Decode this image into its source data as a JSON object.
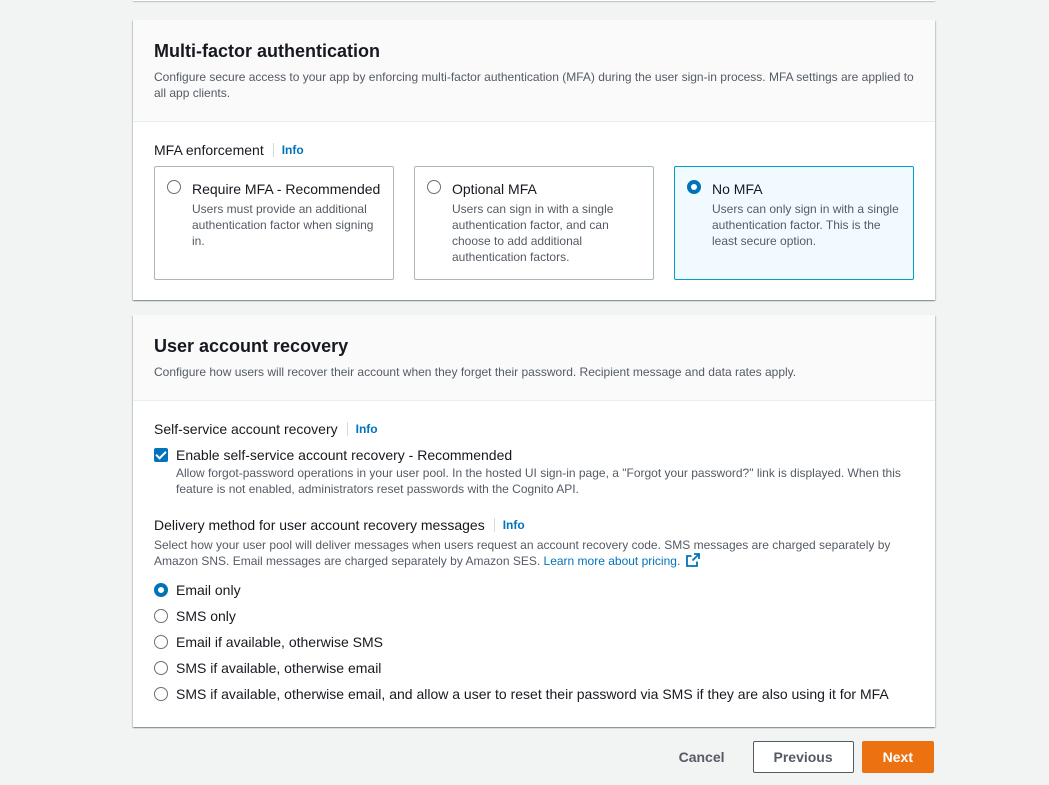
{
  "mfa": {
    "title": "Multi-factor authentication",
    "description": "Configure secure access to your app by enforcing multi-factor authentication (MFA) during the user sign-in process. MFA settings are applied to all app clients.",
    "enforcement_label": "MFA enforcement",
    "info": "Info",
    "options": [
      {
        "title": "Require MFA - Recommended",
        "desc": "Users must provide an additional authentication factor when signing in.",
        "selected": false
      },
      {
        "title": "Optional MFA",
        "desc": "Users can sign in with a single authentication factor, and can choose to add additional authentication factors.",
        "selected": false
      },
      {
        "title": "No MFA",
        "desc": "Users can only sign in with a single authentication factor. This is the least secure option.",
        "selected": true
      }
    ]
  },
  "recovery": {
    "title": "User account recovery",
    "description": "Configure how users will recover their account when they forget their password. Recipient message and data rates apply.",
    "self_service_label": "Self-service account recovery",
    "info": "Info",
    "self_service_checkbox": {
      "label": "Enable self-service account recovery - Recommended",
      "desc": "Allow forgot-password operations in your user pool. In the hosted UI sign-in page, a \"Forgot your password?\" link is displayed. When this feature is not enabled, administrators reset passwords with the Cognito API.",
      "checked": true
    },
    "delivery_label": "Delivery method for user account recovery messages",
    "delivery_desc": "Select how your user pool will deliver messages when users request an account recovery code. SMS messages are charged separately by Amazon SNS. Email messages are charged separately by Amazon SES.",
    "learn_more": "Learn more about pricing.",
    "delivery_options": [
      {
        "label": "Email only",
        "selected": true
      },
      {
        "label": "SMS only",
        "selected": false
      },
      {
        "label": "Email if available, otherwise SMS",
        "selected": false
      },
      {
        "label": "SMS if available, otherwise email",
        "selected": false
      },
      {
        "label": "SMS if available, otherwise email, and allow a user to reset their password via SMS if they are also using it for MFA",
        "selected": false
      }
    ]
  },
  "footer": {
    "cancel": "Cancel",
    "previous": "Previous",
    "next": "Next"
  },
  "colors": {
    "accent": "#0073bb",
    "primary_button": "#ec7211",
    "selected_tile_bg": "#f1faff"
  }
}
